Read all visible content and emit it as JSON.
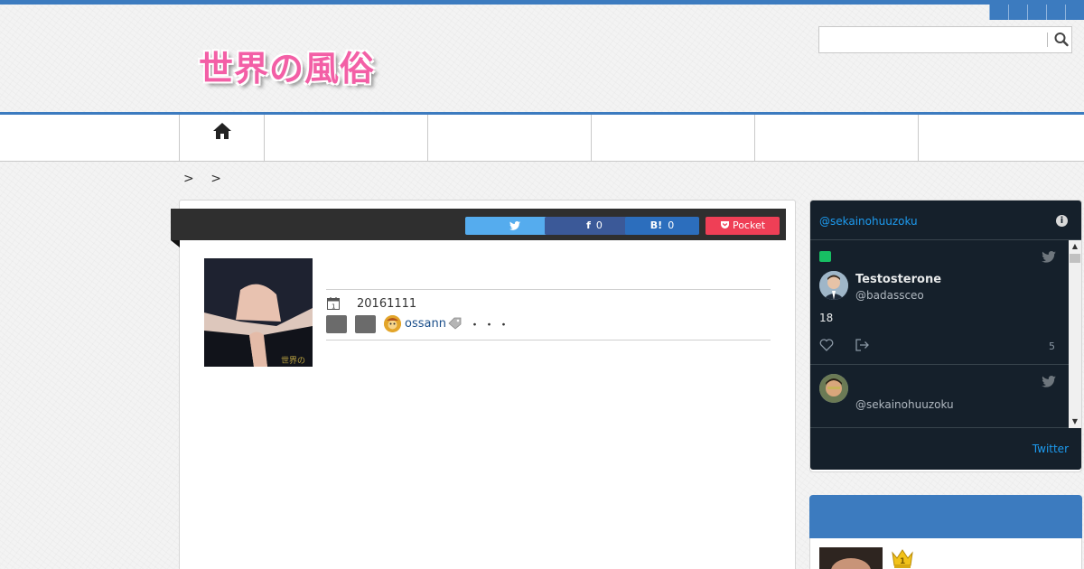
{
  "header": {
    "logo_text": "世界の風俗",
    "top_icons": [
      "twitter-icon",
      "facebook-icon",
      "rss-icon",
      "mail-icon"
    ],
    "search": {
      "value": "",
      "placeholder": ""
    }
  },
  "nav": {
    "home_icon": "home-icon",
    "items": [
      "",
      "",
      "",
      "",
      ""
    ]
  },
  "breadcrumb": {
    "separators": [
      ">",
      ">"
    ]
  },
  "article": {
    "share": {
      "twitter_count": "",
      "facebook_count": "0",
      "hatena_label": "B!",
      "hatena_count": "0",
      "pocket_label": "Pocket"
    },
    "date": "20161111",
    "author": "ossann",
    "more": "・・・"
  },
  "twitter_widget": {
    "handle": "@sekainohuuzoku",
    "tweets": [
      {
        "name": "Testosterone",
        "user": "@badassceo",
        "text": "18",
        "count": "5"
      },
      {
        "name": "",
        "user": "@sekainohuuzoku"
      }
    ],
    "footer_link": "Twitter"
  },
  "colors": {
    "accent": "#3c7bbf",
    "twitter_bg": "#15202b",
    "twitter_link": "#1d9bf0",
    "pocket": "#ef3f56",
    "facebook": "#3b5998",
    "logo_pink": "#f35fa6"
  }
}
